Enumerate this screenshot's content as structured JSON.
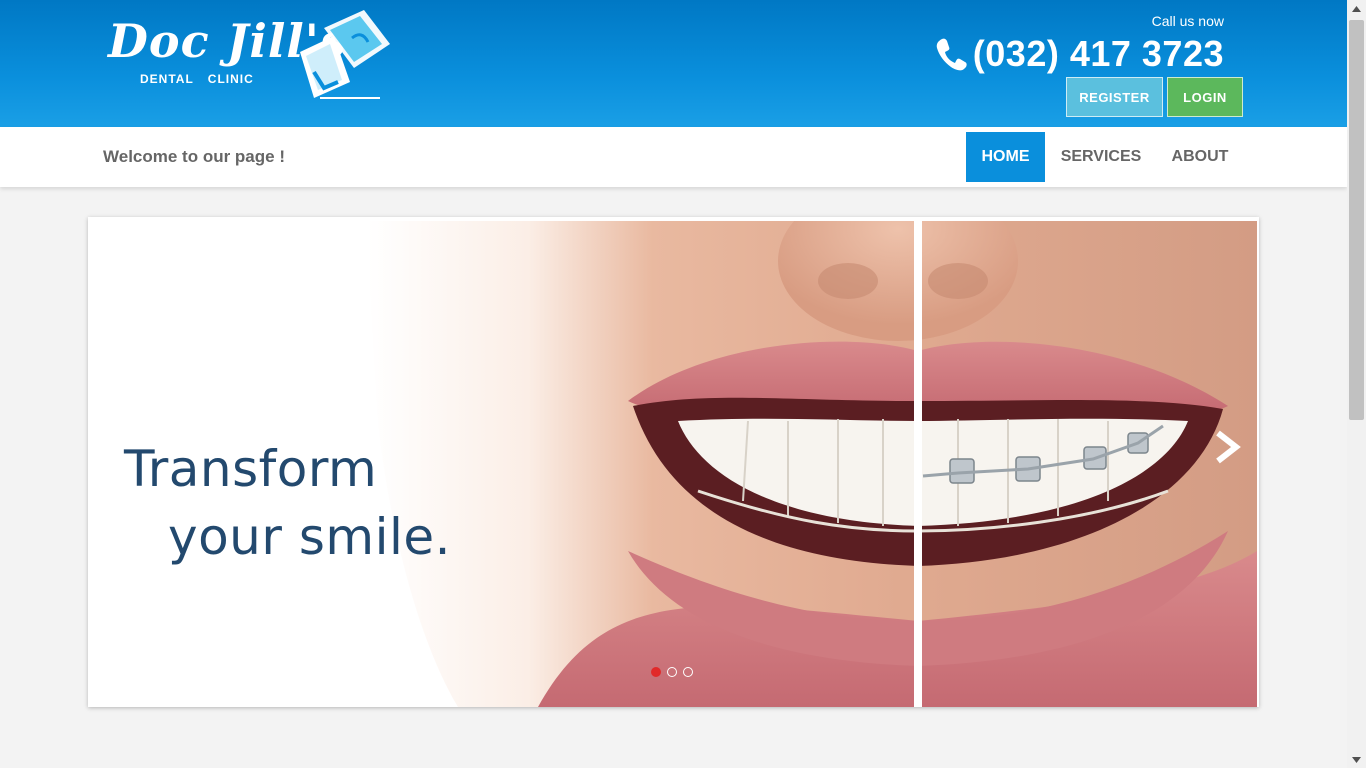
{
  "brand": {
    "logo_script": "Doc Jill's",
    "logo_sub_1": "DENTAL",
    "logo_sub_2": "CLINIC"
  },
  "header": {
    "call_label": "Call us now",
    "phone": "(032) 417 3723",
    "register_label": "REGISTER",
    "login_label": "LOGIN"
  },
  "nav": {
    "welcome": "Welcome to our page !",
    "items": [
      {
        "label": "HOME",
        "active": true
      },
      {
        "label": "SERVICES",
        "active": false
      },
      {
        "label": "ABOUT",
        "active": false
      }
    ]
  },
  "slider": {
    "headline_line1": "Transform",
    "headline_line2": "your smile.",
    "slide_count": 3,
    "active_slide": 1
  },
  "colors": {
    "header_blue": "#0a8fdc",
    "register": "#5bc0de",
    "login": "#5cb85c",
    "active_dot": "#e12a2a",
    "headline": "#23496e"
  }
}
